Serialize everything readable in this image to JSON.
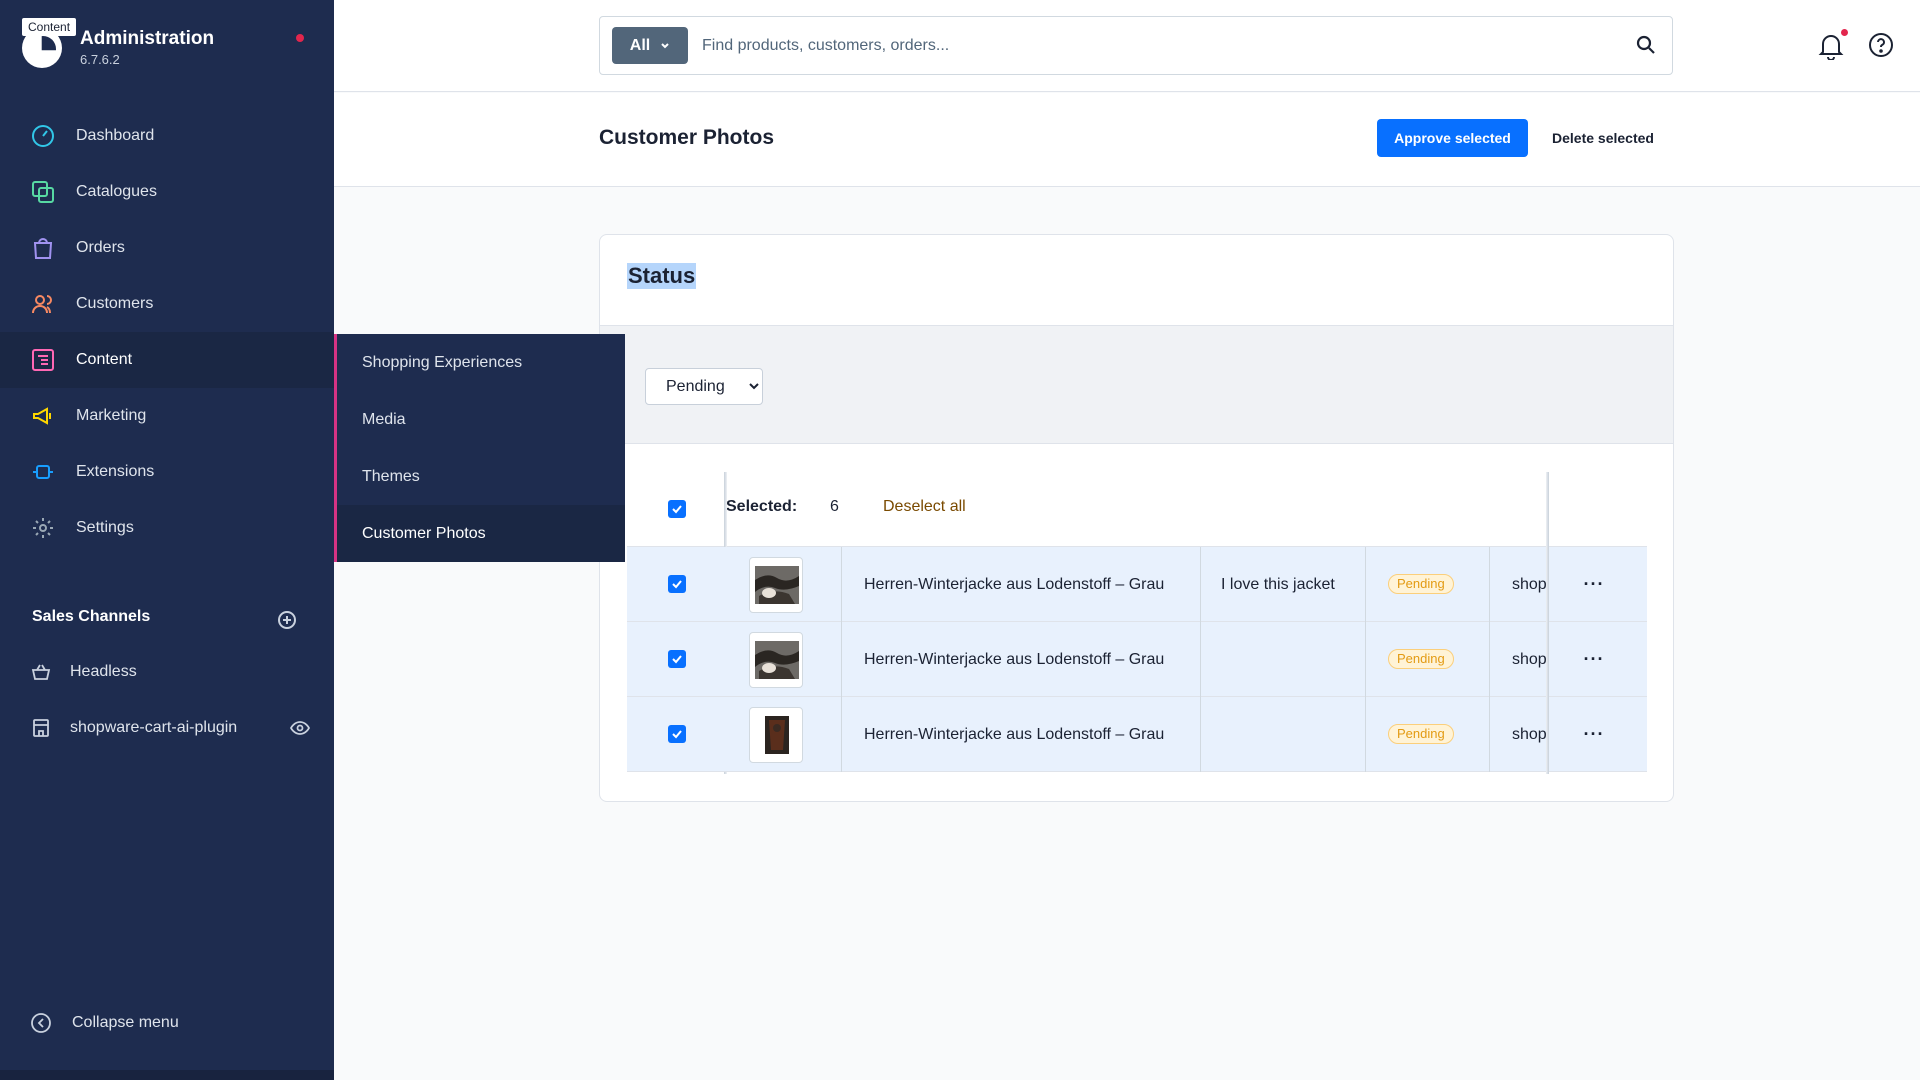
{
  "brand": {
    "tooltip": "Content",
    "name": "Administration",
    "version": "6.7.6.2"
  },
  "nav": [
    {
      "label": "Dashboard",
      "icon": "dashboard-icon",
      "color": "#31c7e8"
    },
    {
      "label": "Catalogues",
      "icon": "catalogue-icon",
      "color": "#57d9a3"
    },
    {
      "label": "Orders",
      "icon": "orders-icon",
      "color": "#a092f0"
    },
    {
      "label": "Customers",
      "icon": "customers-icon",
      "color": "#f88962"
    },
    {
      "label": "Content",
      "icon": "content-icon",
      "color": "#ff68b4"
    },
    {
      "label": "Marketing",
      "icon": "marketing-icon",
      "color": "#ffd700"
    },
    {
      "label": "Extensions",
      "icon": "extensions-icon",
      "color": "#189eff"
    },
    {
      "label": "Settings",
      "icon": "settings-icon",
      "color": "#9aa8b5"
    }
  ],
  "sales_channels": {
    "title": "Sales Channels",
    "items": [
      {
        "label": "Headless",
        "icon": "basket-icon"
      },
      {
        "label": "shopware-cart-ai-plugin",
        "icon": "storefront-icon"
      }
    ]
  },
  "collapse_label": "Collapse menu",
  "flyout": {
    "items": [
      "Shopping Experiences",
      "Media",
      "Themes",
      "Customer Photos"
    ]
  },
  "search": {
    "type_label": "All",
    "placeholder": "Find products, customers, orders..."
  },
  "page": {
    "title": "Customer Photos",
    "approve_label": "Approve selected",
    "delete_label": "Delete selected"
  },
  "card": {
    "title": "Status",
    "filter_value": "Pending",
    "filter_options": [
      "Pending"
    ]
  },
  "grid": {
    "selected_label": "Selected:",
    "selected_count": "6",
    "deselect_label": "Deselect all",
    "rows": [
      {
        "product": "Herren-Winterjacke aus Lodenstoff – Grau",
        "comment": "I love this jacket",
        "status": "Pending",
        "channel": "shop",
        "actions": "···"
      },
      {
        "product": "Herren-Winterjacke aus Lodenstoff – Grau",
        "comment": "",
        "status": "Pending",
        "channel": "shop",
        "actions": "···"
      },
      {
        "product": "Herren-Winterjacke aus Lodenstoff – Grau",
        "comment": "",
        "status": "Pending",
        "channel": "shop",
        "actions": "···"
      }
    ]
  },
  "colors": {
    "sidebar_bg": "#1e2c4f",
    "primary": "#0870ff",
    "pending_badge": "#e39b14",
    "notification_dot": "#e2264d"
  }
}
